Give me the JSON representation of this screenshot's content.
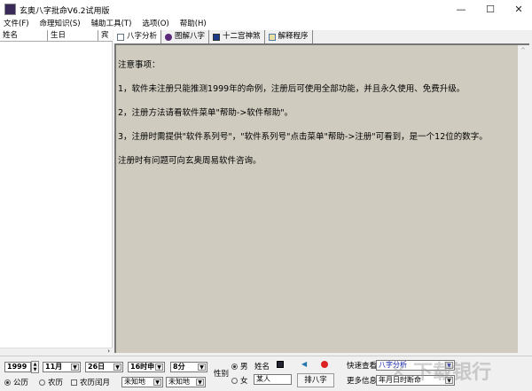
{
  "window": {
    "title": "玄奥八字批命V6.2试用版",
    "minimize": "—",
    "maximize": "☐",
    "close": "✕"
  },
  "menu": [
    "文件(F)",
    "命理知识(S)",
    "辅助工具(T)",
    "选项(O)",
    "帮助(H)"
  ],
  "list": {
    "columns": [
      "姓名",
      "生日",
      "宾"
    ]
  },
  "tabs": [
    {
      "label": "八字分析",
      "icon": "edit-icon"
    },
    {
      "label": "图解八字",
      "icon": "wizard-icon"
    },
    {
      "label": "十二宫神煞",
      "icon": "grid-icon"
    },
    {
      "label": "解释程序",
      "icon": "document-icon"
    }
  ],
  "content": {
    "paragraphs": [
      "注意事项：",
      "1，软件未注册只能推测1999年的命例，注册后可使用全部功能，并且永久使用、免费升级。",
      "2，注册方法请看软件菜单\"帮助->软件帮助\"。",
      "3，注册时需提供\"软件系列号\"，\"软件系列号\"点击菜单\"帮助->注册\"可看到，是一个12位的数字。",
      "注册时有问题可向玄奥周易软件咨询。"
    ]
  },
  "form": {
    "year": "1999",
    "month": "11月",
    "day": "26日",
    "hour": "16时申",
    "minute": "8分",
    "calendar_solar": "公历",
    "calendar_lunar": "农历",
    "leap_month": "农历闰月",
    "place1": "未知地",
    "place2": "未知地",
    "gender_label": "性别",
    "male": "男",
    "female": "女",
    "name_label": "姓名",
    "name_value": "某人",
    "arrange_button": "排八字",
    "quick_view_label": "快速查看",
    "quick_view_value": "八字分析",
    "more_info_label": "更多信息",
    "more_info_value": "年月日时断命"
  },
  "watermark": "下载银行 www.downbank.cn"
}
